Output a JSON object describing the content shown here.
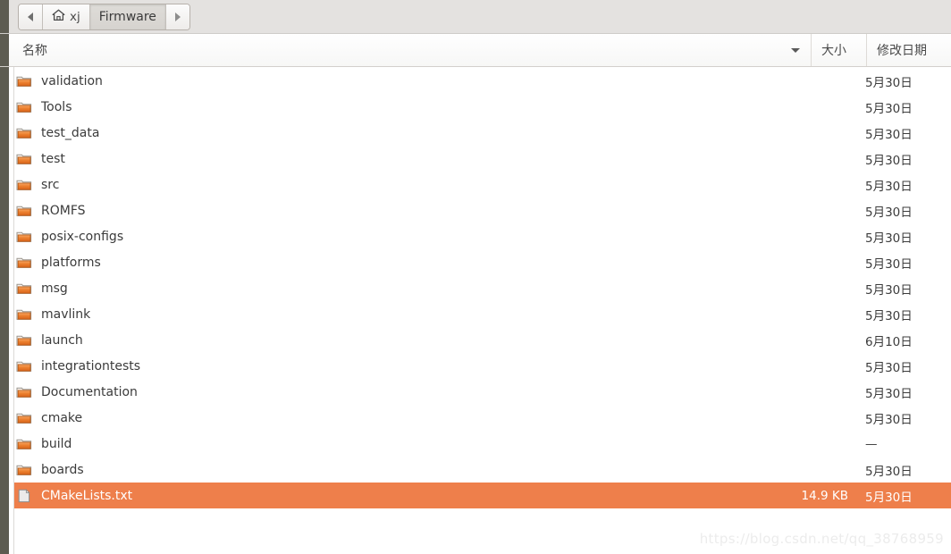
{
  "toolbar": {
    "back_label": "back-arrow",
    "forward_label": "forward-arrow",
    "breadcrumbs": [
      {
        "label": "xj",
        "icon": "home-icon",
        "active": false
      },
      {
        "label": "Firmware",
        "icon": "",
        "active": true
      }
    ]
  },
  "columns": {
    "name": "名称",
    "size": "大小",
    "date": "修改日期",
    "sort_direction": "descending"
  },
  "files": [
    {
      "name": "validation",
      "type": "folder",
      "size": "",
      "date": "5月30日"
    },
    {
      "name": "Tools",
      "type": "folder",
      "size": "",
      "date": "5月30日"
    },
    {
      "name": "test_data",
      "type": "folder",
      "size": "",
      "date": "5月30日"
    },
    {
      "name": "test",
      "type": "folder",
      "size": "",
      "date": "5月30日"
    },
    {
      "name": "src",
      "type": "folder",
      "size": "",
      "date": "5月30日"
    },
    {
      "name": "ROMFS",
      "type": "folder",
      "size": "",
      "date": "5月30日"
    },
    {
      "name": "posix-configs",
      "type": "folder",
      "size": "",
      "date": "5月30日"
    },
    {
      "name": "platforms",
      "type": "folder",
      "size": "",
      "date": "5月30日"
    },
    {
      "name": "msg",
      "type": "folder",
      "size": "",
      "date": "5月30日"
    },
    {
      "name": "mavlink",
      "type": "folder",
      "size": "",
      "date": "5月30日"
    },
    {
      "name": "launch",
      "type": "folder",
      "size": "",
      "date": "6月10日"
    },
    {
      "name": "integrationtests",
      "type": "folder",
      "size": "",
      "date": "5月30日"
    },
    {
      "name": "Documentation",
      "type": "folder",
      "size": "",
      "date": "5月30日"
    },
    {
      "name": "cmake",
      "type": "folder",
      "size": "",
      "date": "5月30日"
    },
    {
      "name": "build",
      "type": "folder",
      "size": "",
      "date": "—"
    },
    {
      "name": "boards",
      "type": "folder",
      "size": "",
      "date": "5月30日"
    },
    {
      "name": "CMakeLists.txt",
      "type": "file",
      "size": "14.9 KB",
      "date": "5月30日",
      "selected": true
    }
  ],
  "watermark": "https://blog.csdn.net/qq_38768959",
  "colors": {
    "selection": "#ee7f4b",
    "folder_icon": "#e8731f",
    "toolbar_bg": "#e4e2e0",
    "gutter": "#5d5c51"
  }
}
